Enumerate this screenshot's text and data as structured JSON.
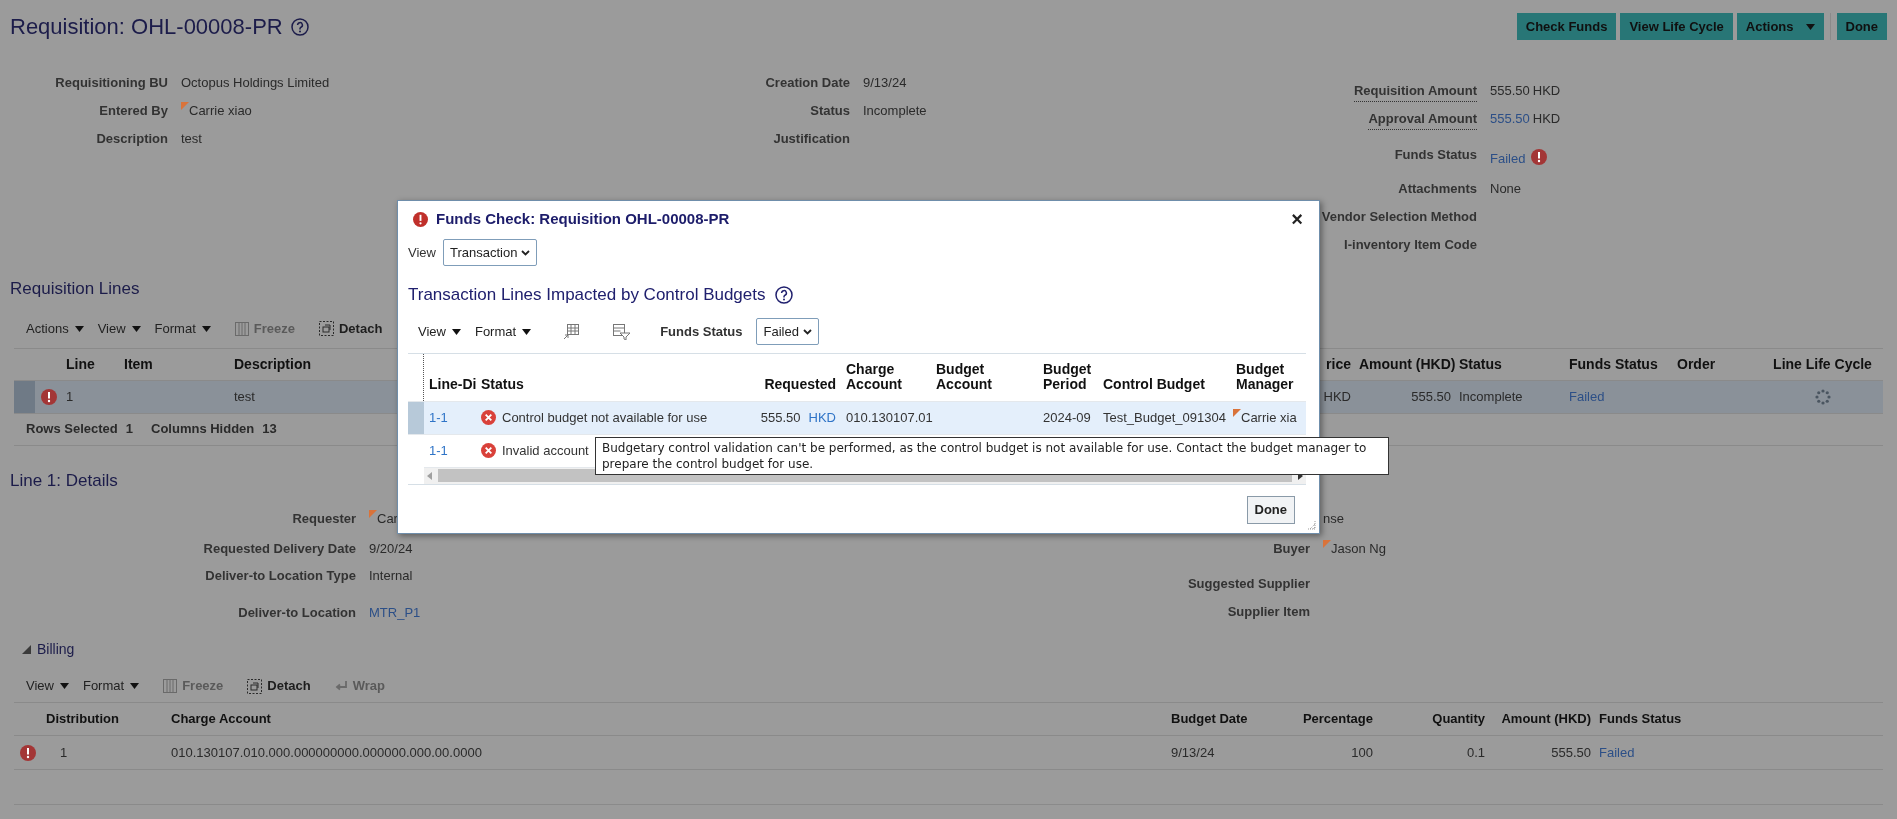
{
  "page": {
    "title": "Requisition: OHL-00008-PR"
  },
  "actions": [
    {
      "label": "Check Funds",
      "kind": "button"
    },
    {
      "label": "View Life Cycle",
      "kind": "button"
    },
    {
      "label": "Actions",
      "kind": "menu"
    },
    {
      "label": "Done",
      "kind": "button"
    }
  ],
  "header": {
    "left": [
      {
        "label": "Requisitioning BU",
        "value": "Octopus Holdings Limited",
        "kind": "text"
      },
      {
        "label": "Entered By",
        "value": "Carrie xiao",
        "kind": "person"
      },
      {
        "label": "Description",
        "value": "test",
        "kind": "text"
      }
    ],
    "middle": [
      {
        "label": "Creation Date",
        "value": "9/13/24",
        "kind": "text"
      },
      {
        "label": "Status",
        "value": "Incomplete",
        "kind": "text"
      },
      {
        "label": "Justification"
      }
    ],
    "right": [
      {
        "label": "Requisition Amount",
        "value": "555.50",
        "unit": "HKD",
        "kind": "amount",
        "hint": true
      },
      {
        "label": "Approval Amount",
        "value": "555.50",
        "unit": "HKD",
        "kind": "link_amount",
        "hint": true
      },
      {
        "label": "Funds Status",
        "value": "Failed",
        "kind": "failed",
        "hint": false
      },
      {
        "label": "Attachments",
        "value": "None",
        "kind": "text",
        "hint": false
      },
      {
        "label": "Vendor Selection Method",
        "hint": false
      },
      {
        "label": "I-inventory Item Code",
        "hint": false
      }
    ]
  },
  "requisition_lines": {
    "title": "Requisition Lines",
    "toolbar": [
      {
        "label": "Actions",
        "kind": "menu"
      },
      {
        "label": "View",
        "kind": "menu"
      },
      {
        "label": "Format",
        "kind": "menu"
      },
      {
        "label": "Freeze",
        "kind": "freeze",
        "disabled": true
      },
      {
        "label": "Detach",
        "kind": "detach",
        "disabled": false
      }
    ],
    "columns": [
      "Line",
      "Item",
      "Description",
      "rice",
      "Amount (HKD)",
      "Status",
      "Funds Status",
      "Order",
      "Line Life Cycle"
    ],
    "rows": [
      {
        "selected": true,
        "error": true,
        "line": "1",
        "description": "test",
        "column_4": "HKD",
        "amount": "555.50",
        "status": "Incomplete",
        "funds_status": "Failed"
      }
    ],
    "footer": [
      {
        "label": "Rows Selected",
        "value": "1"
      },
      {
        "label": "Columns Hidden",
        "value": "13"
      }
    ]
  },
  "line_details": {
    "title": "Line 1: Details",
    "left": [
      {
        "label": "Requester",
        "value": "Car",
        "kind": "person"
      },
      {
        "label": "Requested Delivery Date",
        "value": "9/20/24",
        "kind": "text"
      },
      {
        "label": "Deliver-to Location Type",
        "value": "Internal",
        "kind": "text"
      },
      {
        "label": "Deliver-to Location",
        "value": "MTR_P1",
        "kind": "link"
      }
    ],
    "right": [
      {
        "value": "nse",
        "kind": "text"
      },
      {
        "label": "Buyer",
        "value": "Jason Ng",
        "kind": "person"
      },
      {
        "label": "Suggested Supplier"
      },
      {
        "label": "Supplier Item"
      }
    ]
  },
  "billing": {
    "title": "Billing",
    "expanded": true,
    "toolbar": [
      {
        "label": "View",
        "kind": "menu"
      },
      {
        "label": "Format",
        "kind": "menu"
      },
      {
        "label": "Freeze",
        "kind": "freeze",
        "disabled": true
      },
      {
        "label": "Detach",
        "kind": "detach",
        "disabled": false
      },
      {
        "label": "Wrap",
        "kind": "wrap",
        "disabled": true
      }
    ],
    "columns": [
      "Distribution",
      "Charge Account",
      "Budget Date",
      "Percentage",
      "Quantity",
      "Amount (HKD)",
      "Funds Status"
    ],
    "rows": [
      {
        "error": true,
        "distribution": "1",
        "charge_account": "010.130107.010.000.000000000.000000.000.00.0000",
        "budget_date": "9/13/24",
        "percentage": "100",
        "quantity": "0.1",
        "amount": "555.50",
        "funds_status": "Failed"
      }
    ]
  },
  "dialog": {
    "title": "Funds Check: Requisition OHL-00008-PR",
    "close": "×",
    "view": {
      "label": "View",
      "value": "Transaction"
    },
    "heading": "Transaction Lines Impacted by Control Budgets",
    "toolbar": [
      {
        "label": "View",
        "kind": "menu"
      },
      {
        "label": "Format",
        "kind": "menu"
      }
    ],
    "funds_status": {
      "label": "Funds Status",
      "value": "Failed"
    },
    "columns": [
      "Line-Di",
      "Status",
      "Requested",
      "Charge Account",
      "Budget Account",
      "Budget Period",
      "Control Budget",
      "Budget Manager"
    ],
    "rows": [
      {
        "selected": true,
        "line": "1-1",
        "status": "Control budget not available for use",
        "requested": "555.50",
        "currency": "HKD",
        "charge_account": "010.130107.01",
        "budget_period": "2024-09",
        "control_budget": "Test_Budget_091304",
        "budget_manager": "Carrie xia"
      },
      {
        "selected": false,
        "line": "1-1",
        "status": "Invalid account"
      }
    ],
    "tooltip": "Budgetary control validation can't be performed, as the control budget is not available for use. Contact the budget manager to prepare the control budget for use.",
    "done": "Done"
  }
}
